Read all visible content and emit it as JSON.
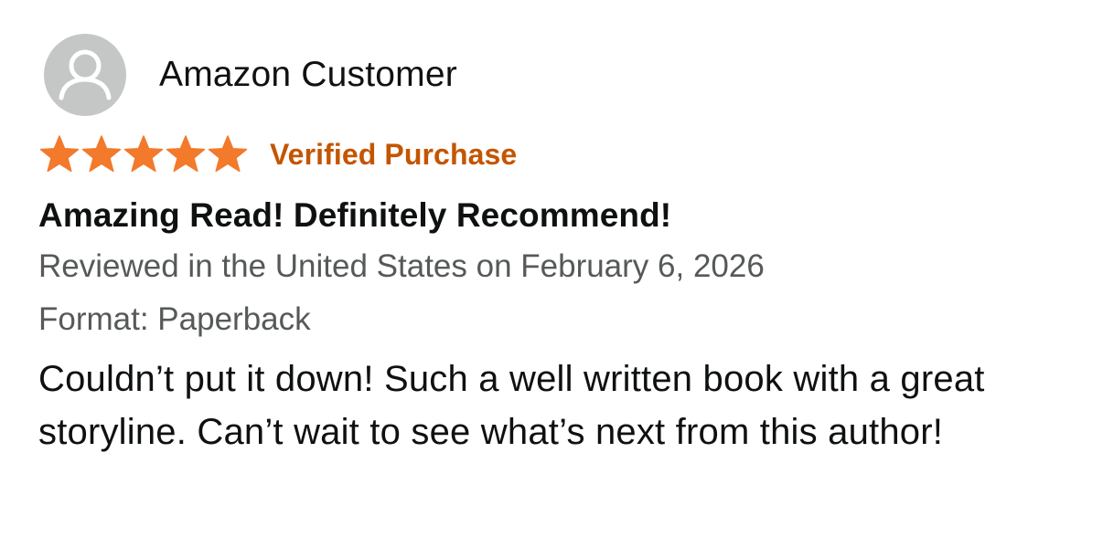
{
  "review": {
    "profile_name": "Amazon Customer",
    "avatar_icon": "person-icon",
    "rating": 5,
    "rating_max": 5,
    "star_color": "#f3792b",
    "verified_label": "Verified Purchase",
    "verified_color": "#c45500",
    "title": "Amazing Read! Definitely Recommend!",
    "date_line": "Reviewed in the United States on February 6, 2026",
    "format_line": "Format: Paperback",
    "body": "Couldn’t put it down! Such a well written book with a great storyline. Can’t wait to see what’s next from this author!"
  }
}
